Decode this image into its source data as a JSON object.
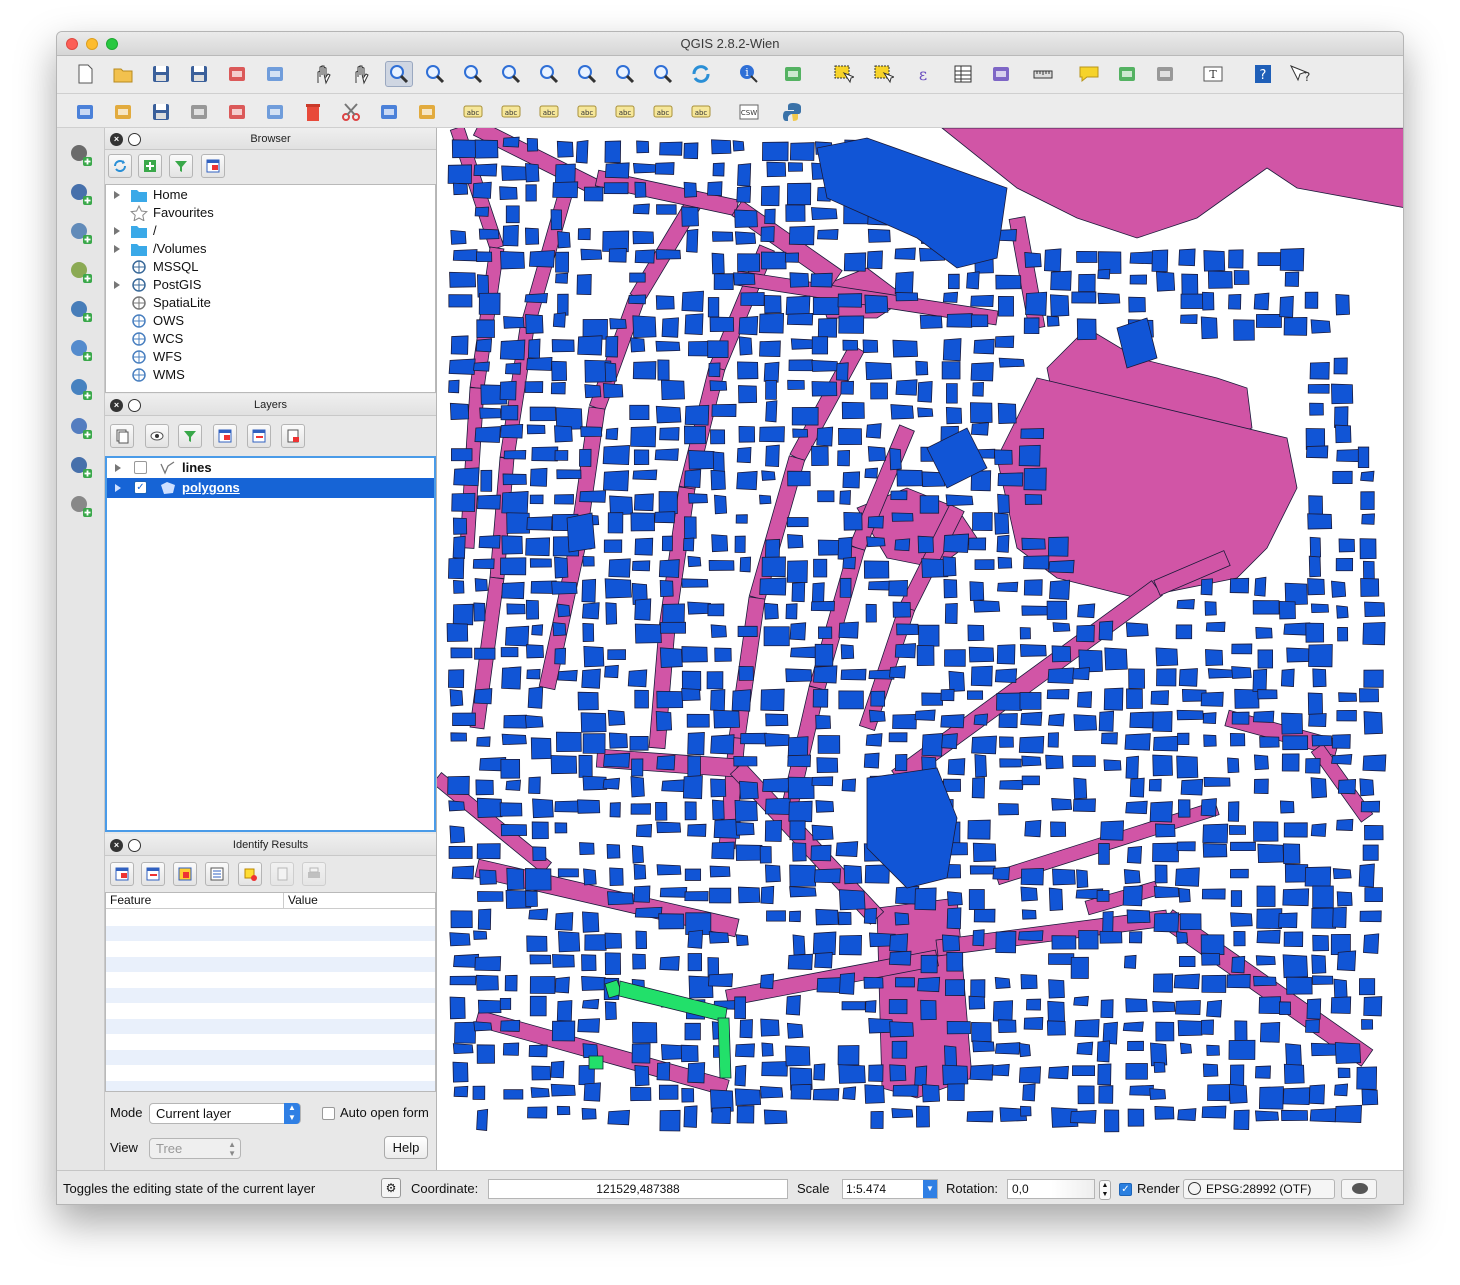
{
  "window": {
    "title": "QGIS 2.8.2-Wien"
  },
  "toolbar_main": {
    "icons": [
      "new-project-icon",
      "open-project-icon",
      "save-project-icon",
      "save-as-icon",
      "new-print-composer-icon",
      "composer-manager-icon",
      "pan-icon",
      "pan-to-selection-icon",
      "zoom-in-icon",
      "zoom-out-icon",
      "zoom-actual-size-icon",
      "zoom-full-icon",
      "zoom-to-selection-icon",
      "zoom-to-layer-icon",
      "zoom-last-icon",
      "zoom-next-icon",
      "refresh-icon",
      "identify-icon",
      "run-feature-action-icon",
      "select-features-icon",
      "deselect-features-icon",
      "field-calculator-icon",
      "attribute-table-icon",
      "statistical-summary-icon",
      "measure-icon",
      "map-tips-icon",
      "new-bookmark-icon",
      "show-bookmarks-icon",
      "text-annotation-icon",
      "help-icon",
      "whats-this-icon"
    ]
  },
  "toolbar_digitize": {
    "icons": [
      "current-edits-icon",
      "toggle-editing-icon",
      "save-layer-edits-icon",
      "add-feature-icon",
      "move-feature-icon",
      "node-tool-icon",
      "delete-selected-icon",
      "cut-features-icon",
      "copy-features-icon",
      "paste-features-icon",
      "label-tool-icon",
      "pin-labels-icon",
      "highlight-pinned-labels-icon",
      "show-hide-labels-icon",
      "move-label-icon",
      "rotate-label-icon",
      "change-label-icon",
      "csw-icon",
      "python-console-icon"
    ],
    "csw_label": "CSW"
  },
  "layer_toolbar": {
    "icons": [
      "add-vector-layer-icon",
      "add-raster-layer-icon",
      "add-postgis-layer-icon",
      "add-spatialite-layer-icon",
      "add-mssql-layer-icon",
      "add-wms-layer-icon",
      "add-wcs-layer-icon",
      "add-wfs-layer-icon",
      "add-delimited-text-icon",
      "new-shapefile-layer-icon"
    ]
  },
  "browser": {
    "title": "Browser",
    "items": [
      {
        "label": "Home",
        "icon": "folder-icon",
        "expandable": true
      },
      {
        "label": "Favourites",
        "icon": "star-icon",
        "expandable": false
      },
      {
        "label": "/",
        "icon": "folder-icon",
        "expandable": true
      },
      {
        "label": "/Volumes",
        "icon": "folder-icon",
        "expandable": true
      },
      {
        "label": "MSSQL",
        "icon": "mssql-icon",
        "expandable": false
      },
      {
        "label": "PostGIS",
        "icon": "postgis-icon",
        "expandable": true
      },
      {
        "label": "SpatiaLite",
        "icon": "spatialite-icon",
        "expandable": false
      },
      {
        "label": "OWS",
        "icon": "ows-icon",
        "expandable": false
      },
      {
        "label": "WCS",
        "icon": "wcs-icon",
        "expandable": false
      },
      {
        "label": "WFS",
        "icon": "wfs-icon",
        "expandable": false
      },
      {
        "label": "WMS",
        "icon": "wms-icon",
        "expandable": false
      }
    ]
  },
  "layers": {
    "title": "Layers",
    "items": [
      {
        "label": "lines",
        "checked": false,
        "selected": false
      },
      {
        "label": "polygons",
        "checked": true,
        "selected": true
      }
    ]
  },
  "identify": {
    "title": "Identify Results",
    "col_feature": "Feature",
    "col_value": "Value",
    "mode_label": "Mode",
    "mode_value": "Current layer",
    "auto_open_label": "Auto open form",
    "view_label": "View",
    "view_value": "Tree",
    "help_label": "Help"
  },
  "status": {
    "message": "Toggles the editing state of the current layer",
    "coordinate_label": "Coordinate:",
    "coordinate_value": "121529,487388",
    "scale_label": "Scale",
    "scale_value": "1:5.474",
    "rotation_label": "Rotation:",
    "rotation_value": "0,0",
    "render_label": "Render",
    "render_checked": true,
    "crs_label": "EPSG:28992 (OTF)"
  },
  "colors": {
    "buildings": "#1155d6",
    "canals": "#d155a6",
    "selection": "#22e06a",
    "selected_row": "#1664d6"
  }
}
